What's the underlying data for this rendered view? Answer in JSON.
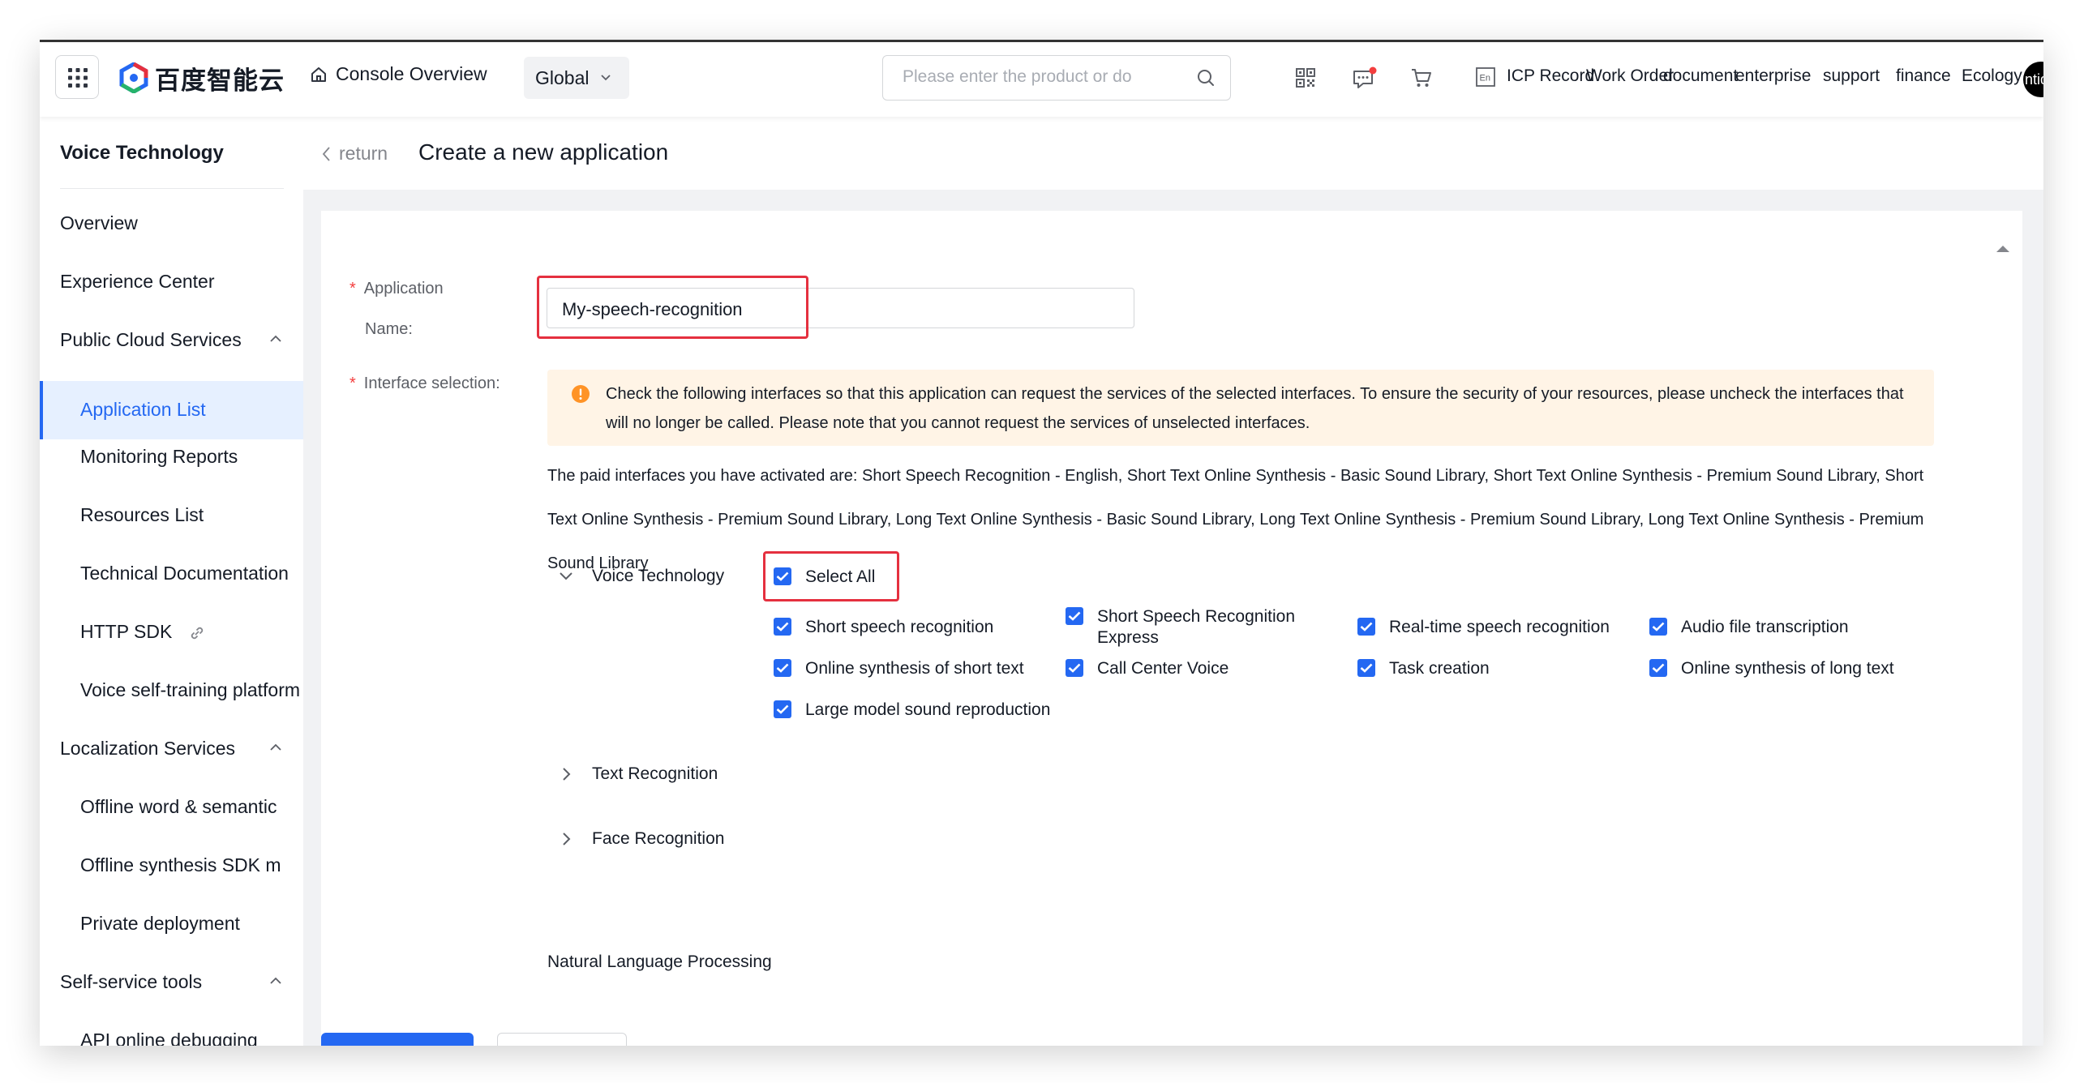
{
  "header": {
    "brand": "百度智能云",
    "console_overview": "Console Overview",
    "region": "Global",
    "search_placeholder": "Please enter the product or do",
    "links": {
      "icp": "ICP Record",
      "work_order": "Work Order",
      "document": "document",
      "enterprise": "enterprise",
      "support": "support",
      "finance": "finance",
      "ecology": "Ecology"
    },
    "avatar_text": "ntiq"
  },
  "sidebar": {
    "title": "Voice Technology",
    "items": [
      {
        "label": "Overview"
      },
      {
        "label": "Experience Center"
      },
      {
        "label": "Public Cloud Services"
      },
      {
        "label": "Application List"
      },
      {
        "label": "Monitoring Reports"
      },
      {
        "label": "Resources List"
      },
      {
        "label": "Technical Documentation"
      },
      {
        "label": "HTTP SDK"
      },
      {
        "label": "Voice self-training platform"
      },
      {
        "label": "Localization Services"
      },
      {
        "label": "Offline word & semantic"
      },
      {
        "label": "Offline synthesis SDK m"
      },
      {
        "label": "Private deployment"
      },
      {
        "label": "Self-service tools"
      },
      {
        "label": "API online debugging"
      }
    ]
  },
  "page": {
    "back_label": "return",
    "title": "Create a new application"
  },
  "form": {
    "app_name_label_1": "Application",
    "app_name_label_2": "Name:",
    "app_name_value": "My-speech-recognition",
    "interface_label": "Interface selection:",
    "notice": "Check the following interfaces so that this application can request the services of the selected interfaces. To ensure the security of your resources, please uncheck the interfaces that will no longer be called. Please note that you cannot request the services of unselected interfaces.",
    "paid_interfaces": "The paid interfaces you have activated are: Short Speech Recognition - English, Short Text Online Synthesis - Basic Sound Library, Short Text Online Synthesis - Premium Sound Library, Short Text Online Synthesis - Premium Sound Library, Long Text Online Synthesis - Basic Sound Library, Long Text Online Synthesis - Premium Sound Library, Long Text Online Synthesis - Premium Sound Library",
    "voice_group": "Voice Technology",
    "select_all": "Select All",
    "interfaces": [
      {
        "label": "Short speech recognition",
        "checked": true
      },
      {
        "label": "Short Speech Recognition Express",
        "checked": true
      },
      {
        "label": "Real-time speech recognition",
        "checked": true
      },
      {
        "label": "Audio file transcription",
        "checked": true
      },
      {
        "label": "Online synthesis of short text",
        "checked": true
      },
      {
        "label": "Call Center Voice",
        "checked": true
      },
      {
        "label": "Task creation",
        "checked": true
      },
      {
        "label": "Online synthesis of long text",
        "checked": true
      },
      {
        "label": "Large model sound reproduction",
        "checked": true
      }
    ],
    "text_group": "Text Recognition",
    "face_group": "Face Recognition",
    "nlp_group": "Natural Language Processing"
  },
  "colors": {
    "primary": "#2468f2",
    "highlight": "#e5303f",
    "warning": "#ff9326",
    "notice_bg": "#fff4e6"
  }
}
